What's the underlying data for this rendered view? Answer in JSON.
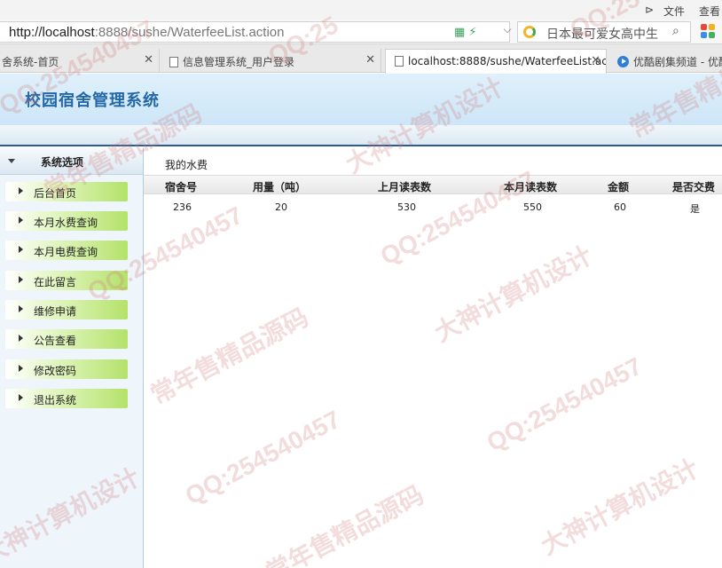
{
  "browser": {
    "menu": {
      "file": "文件",
      "view": "查看"
    },
    "url": {
      "host": "http://localhost",
      "rest": ":8888/sushe/WaterfeeList.action"
    },
    "search_text": "日本最可爱女高中生",
    "tabs": [
      {
        "label": "舍系统-首页"
      },
      {
        "label": "信息管理系统_用户登录"
      },
      {
        "label": "localhost:8888/sushe/WaterfeeList.ac"
      },
      {
        "label": "优酷剧集频道 - 优酷"
      }
    ]
  },
  "app": {
    "title": "校园宿舍管理系统"
  },
  "sidebar": {
    "heading": "系统选项",
    "items": [
      {
        "label": "后台首页"
      },
      {
        "label": "本月水费查询"
      },
      {
        "label": "本月电费查询"
      },
      {
        "label": "在此留言"
      },
      {
        "label": "维修申请"
      },
      {
        "label": "公告查看"
      },
      {
        "label": "修改密码"
      },
      {
        "label": "退出系统"
      }
    ]
  },
  "main": {
    "breadcrumb": "我的水费",
    "columns": [
      "宿舍号",
      "用量（吨）",
      "上月读表数",
      "本月读表数",
      "金额",
      "是否交费"
    ],
    "rows": [
      [
        "236",
        "20",
        "530",
        "550",
        "60",
        "是"
      ]
    ]
  },
  "watermark": {
    "qq": "QQ:254540457",
    "qq_partial": "QQ:25",
    "sell": "常年售精品源码",
    "design": "大神计算机设计"
  }
}
